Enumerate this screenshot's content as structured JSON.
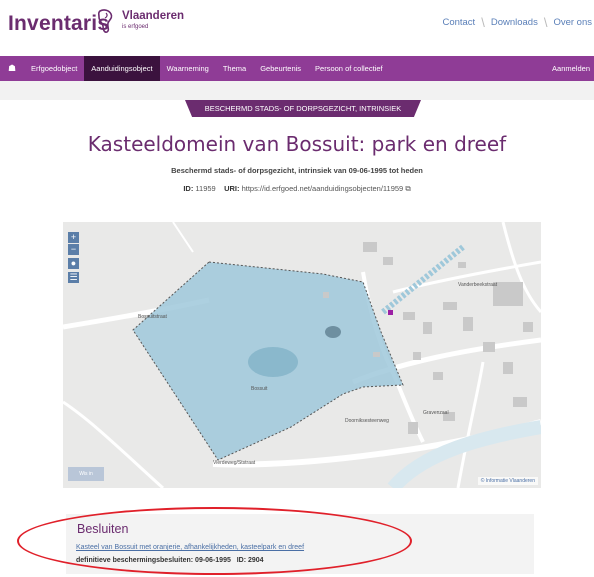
{
  "header": {
    "brand": "Inventaris",
    "logo_name": "Vlaanderen",
    "logo_sub": "is erfgoed",
    "links": [
      "Contact",
      "Downloads",
      "Over ons"
    ]
  },
  "nav": {
    "home_icon": "home-icon",
    "items": [
      "Erfgoedobject",
      "Aanduidingsobject",
      "Waarneming",
      "Thema",
      "Gebeurtenis",
      "Persoon of collectief"
    ],
    "active": "Aanduidingsobject",
    "login": "Aanmelden"
  },
  "ribbon": "BESCHERMD STADS- OF DORPSGEZICHT, INTRINSIEK",
  "title": "Kasteeldomein van Bossuit: park en dreef",
  "subtitle": "Beschermd stads- of dorpsgezicht, intrinsiek van 09-06-1995 tot heden",
  "ids": {
    "id_label": "ID:",
    "id_value": "11959",
    "uri_label": "URI:",
    "uri_value": "https://id.erfgoed.net/aanduidingsobjecten/11959"
  },
  "map": {
    "controls": [
      "+",
      "−"
    ],
    "icons": [
      "globe-icon",
      "layers-icon"
    ],
    "bottom_button": "Wis in",
    "attribution": "© Informatie Vlaanderen",
    "labels": [
      "Bossuitstraat",
      "Bossuit",
      "Vierdeweg/Ststraat",
      "Doorniksesteenweg",
      "Gravenzaal",
      "Vanderbeekstraat"
    ],
    "colors": {
      "area_fill": "#9fc8da",
      "area_stroke": "#555555",
      "background": "#e9e9e8",
      "buildings": "#c9c9c9"
    }
  },
  "besluiten": {
    "heading": "Besluiten",
    "link": "Kasteel van Bossuit met oranjerie, afhankelijkheden, kasteelpark en dreef",
    "info_label": "definitieve beschermingsbesluiten:",
    "info_date": "09-06-1995",
    "info_id_label": "ID:",
    "info_id": "2904"
  },
  "colors": {
    "brand": "#6b2c6f",
    "nav": "#8f3c96",
    "nav_active": "#3b123e",
    "highlight": "#e0202a",
    "link": "#4a6fa5"
  }
}
